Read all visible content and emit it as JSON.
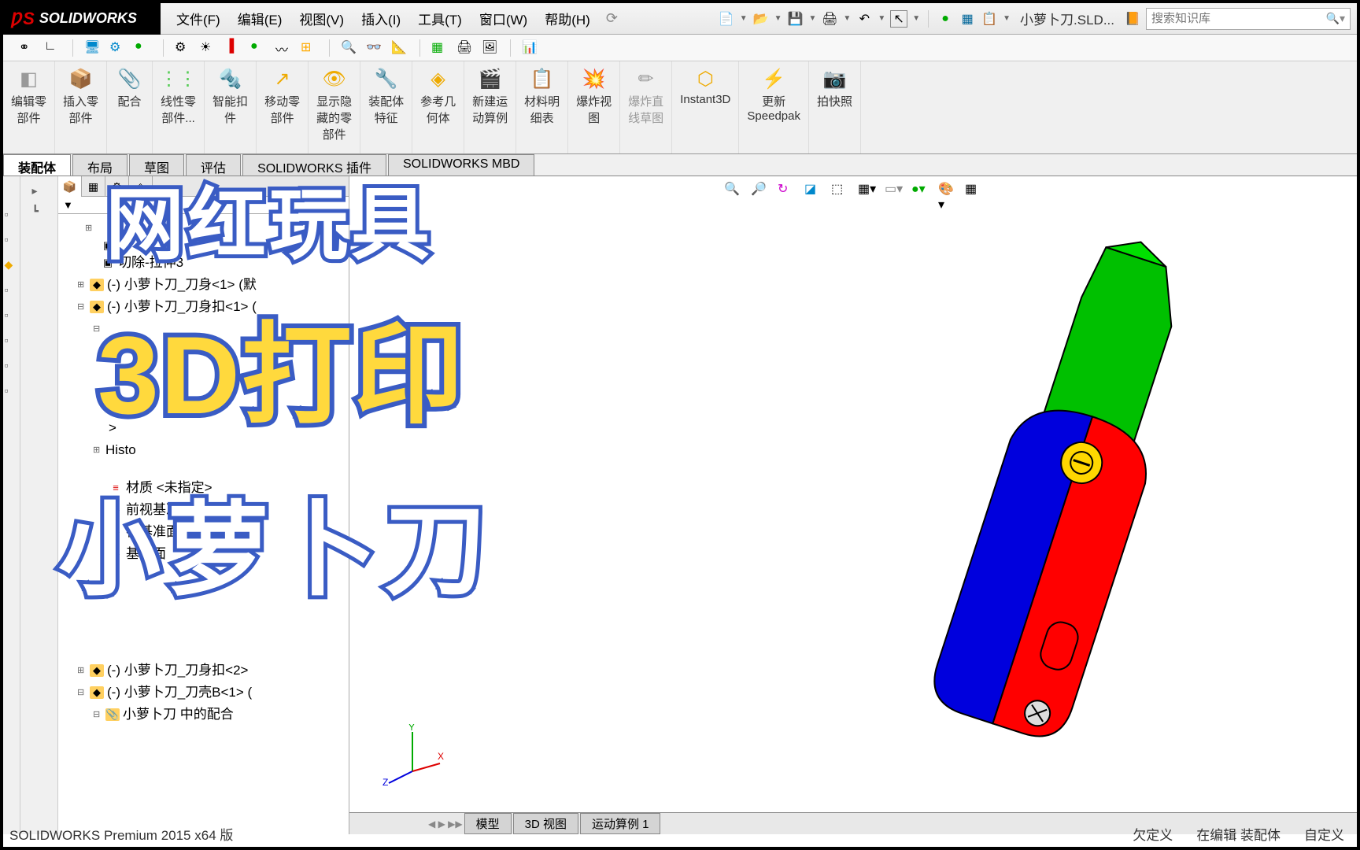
{
  "app": {
    "name": "SOLIDWORKS"
  },
  "menu": {
    "file": "文件(F)",
    "edit": "编辑(E)",
    "view": "视图(V)",
    "insert": "插入(I)",
    "tools": "工具(T)",
    "window": "窗口(W)",
    "help": "帮助(H)"
  },
  "filename": "小萝卜刀.SLD...",
  "search": {
    "placeholder": "搜索知识库"
  },
  "ribbon": {
    "edit_component": "编辑零\n部件",
    "insert_component": "插入零\n部件",
    "mate": "配合",
    "linear_component": "线性零\n部件...",
    "smart_fastener": "智能扣\n件",
    "move_component": "移动零\n部件",
    "show_hide": "显示隐\n藏的零\n部件",
    "assembly_feature": "装配体\n特征",
    "reference_geom": "参考几\n何体",
    "new_motion": "新建运\n动算例",
    "bom": "材料明\n细表",
    "exploded_view": "爆炸视\n图",
    "exploded_sketch": "爆炸直\n线草图",
    "instant3d": "Instant3D",
    "speedpak": "更新\nSpeedpak",
    "snapshot": "拍快照"
  },
  "tabs": {
    "assembly": "装配体",
    "layout": "布局",
    "sketch": "草图",
    "evaluate": "评估",
    "addins": "SOLIDWORKS 插件",
    "mbd": "SOLIDWORKS MBD"
  },
  "tree": {
    "cut_extrude": "切除-拉伸3",
    "part1": "(-) 小萝卜刀_刀身<1> (默",
    "part2": "(-) 小萝卜刀_刀身扣<1> (",
    "history": "Histo",
    "material": "材质 <未指定>",
    "front_plane": "前视基准面",
    "side_plane": "视基准面",
    "plane3": "基准面",
    "part3": "(-) 小萝卜刀_刀身扣<2>",
    "part4": "(-) 小萝卜刀_刀壳B<1> (",
    "mates": "小萝卜刀 中的配合"
  },
  "bottom_tabs": {
    "model": "模型",
    "view3d": "3D 视图",
    "motion": "运动算例 1"
  },
  "status": {
    "version": "SOLIDWORKS Premium 2015 x64 版",
    "underdef": "欠定义",
    "editing": "在编辑 装配体",
    "custom": "自定义"
  },
  "overlay": {
    "line1": "网红玩具",
    "line2": "3D打印",
    "line3": "小萝卜刀"
  }
}
